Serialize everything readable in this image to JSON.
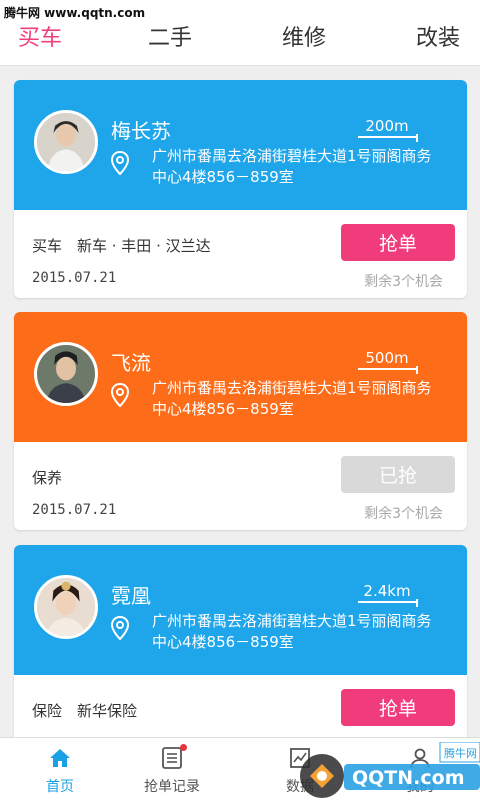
{
  "watermark": "腾牛网 www.qqtn.com",
  "tabs": [
    {
      "label": "买车",
      "active": true
    },
    {
      "label": "二手",
      "active": false
    },
    {
      "label": "维修",
      "active": false
    },
    {
      "label": "改装",
      "active": false
    }
  ],
  "cards": [
    {
      "color": "#1ea5ea",
      "name": "梅长苏",
      "distance": "200m",
      "address": "广州市番禺去洛浦街碧桂大道1号丽阁商务中心4楼856－859室",
      "tags": "买车　新车 · 丰田 · 汉兰达",
      "date": "2015.07.21",
      "button": "抢单",
      "button_state": "active",
      "remaining": "剩余3个机会"
    },
    {
      "color": "#fd6d19",
      "name": "飞流",
      "distance": "500m",
      "address": "广州市番禺去洛浦街碧桂大道1号丽阁商务中心4楼856－859室",
      "tags": "保养",
      "date": "2015.07.21",
      "button": "已抢",
      "button_state": "disabled",
      "remaining": "剩余3个机会"
    },
    {
      "color": "#1ea5ea",
      "name": "霓凰",
      "distance": "2.4km",
      "address": "广州市番禺去洛浦街碧桂大道1号丽阁商务中心4楼856－859室",
      "tags": "保险　新华保险",
      "date": "",
      "button": "抢单",
      "button_state": "active",
      "remaining": ""
    }
  ],
  "bottom_nav": [
    {
      "label": "首页",
      "icon": "home-icon",
      "active": true
    },
    {
      "label": "抢单记录",
      "icon": "list-icon",
      "active": false,
      "badge": true
    },
    {
      "label": "数据",
      "icon": "chart-icon",
      "active": false
    },
    {
      "label": "我的",
      "icon": "user-icon",
      "active": false
    }
  ],
  "overlay_logo": "QQTN.com 腾牛网",
  "accent_color": "#f03c7b",
  "nav_active_color": "#1aa0e6"
}
